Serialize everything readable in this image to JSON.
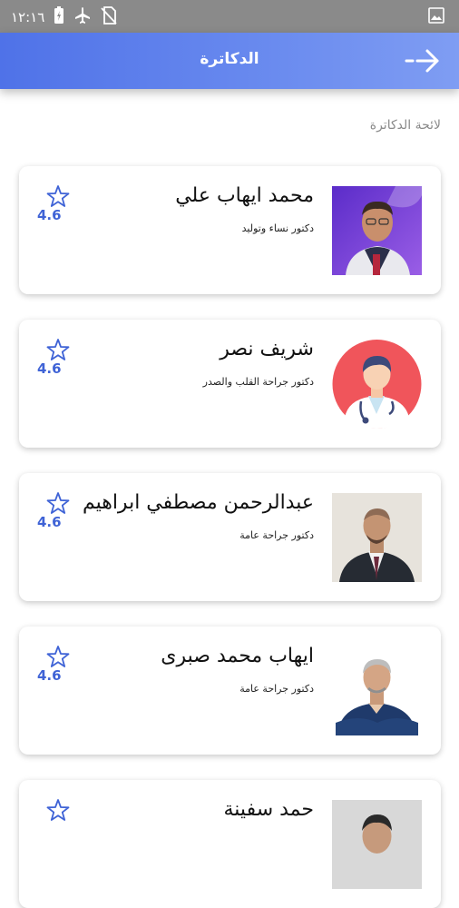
{
  "status_bar": {
    "time": "١٢:١٦"
  },
  "app_bar": {
    "title": "الدكاترة"
  },
  "section_title": "لائحة الدكاترة",
  "colors": {
    "accent": "#4f72e8",
    "rating": "#3f63d6"
  },
  "doctors": [
    {
      "name": "محمد ايهاب علي",
      "specialty": "دكتور نساء وتوليد",
      "rating": "4.6"
    },
    {
      "name": "شريف نصر",
      "specialty": "دكتور جراحة القلب والصدر",
      "rating": "4.6"
    },
    {
      "name": "عبدالرحمن مصطفي ابراهيم",
      "specialty": "دكتور جراحة عامة",
      "rating": "4.6"
    },
    {
      "name": "ايهاب محمد صبرى",
      "specialty": "دكتور جراحة عامة",
      "rating": "4.6"
    },
    {
      "name": "حمد سفينة",
      "specialty": "",
      "rating": ""
    }
  ]
}
